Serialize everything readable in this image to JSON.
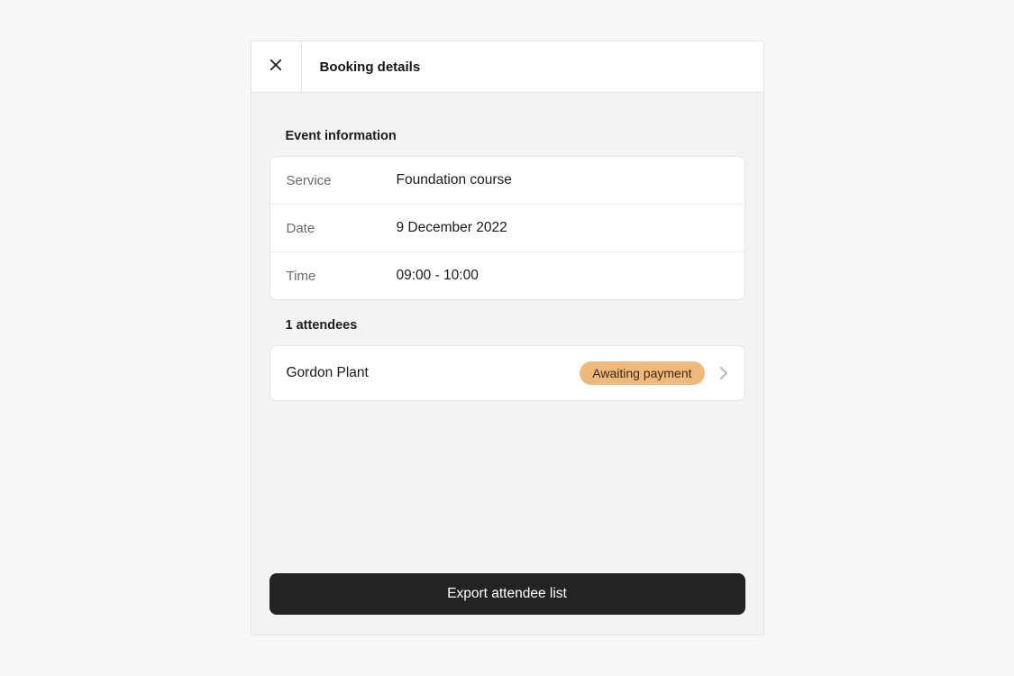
{
  "header": {
    "title": "Booking details"
  },
  "event": {
    "section_title": "Event information",
    "labels": {
      "service": "Service",
      "date": "Date",
      "time": "Time"
    },
    "values": {
      "service": "Foundation course",
      "date": "9 December 2022",
      "time": "09:00 - 10:00"
    }
  },
  "attendees": {
    "section_title": "1 attendees",
    "items": [
      {
        "name": "Gordon Plant",
        "status": "Awaiting payment"
      }
    ]
  },
  "actions": {
    "export_label": "Export attendee list"
  },
  "colors": {
    "badge_bg": "#eeb97a",
    "panel_bg": "#f3f3f3",
    "primary_btn_bg": "#232323"
  }
}
